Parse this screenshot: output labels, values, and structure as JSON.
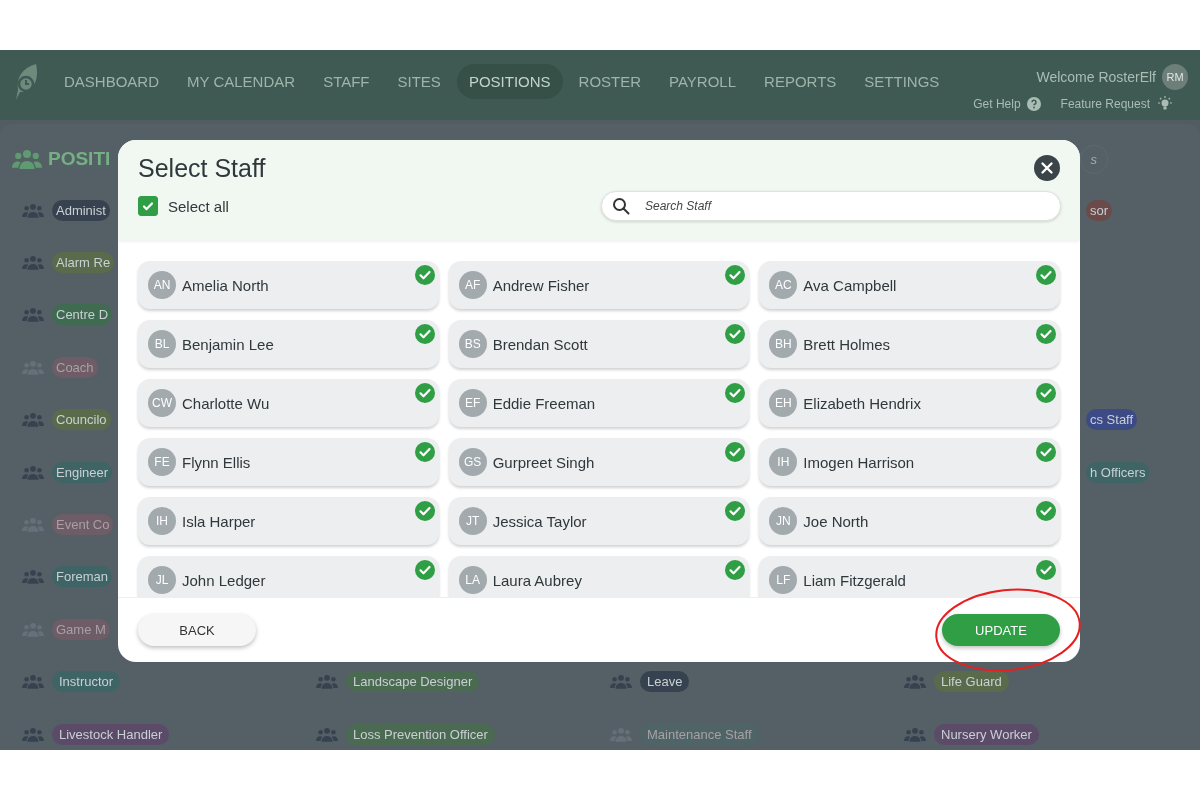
{
  "nav": {
    "items": [
      {
        "label": "DASHBOARD",
        "selected": false
      },
      {
        "label": "MY CALENDAR",
        "selected": false
      },
      {
        "label": "STAFF",
        "selected": false
      },
      {
        "label": "SITES",
        "selected": false
      },
      {
        "label": "POSITIONS",
        "selected": true
      },
      {
        "label": "ROSTER",
        "selected": false
      },
      {
        "label": "PAYROLL",
        "selected": false
      },
      {
        "label": "REPORTS",
        "selected": false
      },
      {
        "label": "SETTINGS",
        "selected": false
      }
    ],
    "welcome": "Welcome RosterElf",
    "avatar": "RM",
    "help": "Get Help",
    "feature": "Feature Request"
  },
  "background": {
    "title": "POSITI",
    "search_placeholder": "s",
    "rows": [
      {
        "left": {
          "label": "Administ",
          "color": "#36424f",
          "disabled": false
        },
        "right": {
          "label": "sor",
          "color": "#6b4a4a",
          "disabled": false
        }
      },
      {
        "left": {
          "label": "Alarm Re",
          "color": "#5a6b4c",
          "disabled": false
        }
      },
      {
        "left": {
          "label": "Centre D",
          "color": "#3f6b50",
          "disabled": false
        }
      },
      {
        "left": {
          "label": "Coach",
          "color": "#6e5c66",
          "disabled": true
        }
      },
      {
        "left": {
          "label": "Councilo",
          "color": "#5a6b4c",
          "disabled": false
        },
        "right": {
          "label": "cs Staff",
          "color": "#3c4a86",
          "disabled": false
        }
      },
      {
        "left": {
          "label": "Engineer",
          "color": "#3e6466",
          "disabled": false
        },
        "right": {
          "label": "h Officers",
          "color": "#3e6466",
          "disabled": false
        }
      },
      {
        "left": {
          "label": "Event Co",
          "color": "#6e5c66",
          "disabled": true
        }
      },
      {
        "left": {
          "label": "Foreman",
          "color": "#3e6466",
          "disabled": false
        }
      },
      {
        "left": {
          "label": "Game M",
          "color": "#6e5c66",
          "disabled": true
        }
      },
      {
        "cells": [
          {
            "label": "Instructor",
            "color": "#3e6466",
            "disabled": false
          },
          {
            "label": "Landscape Designer",
            "color": "#4b6a52",
            "disabled": false
          },
          {
            "label": "Leave",
            "color": "#36424f",
            "disabled": false
          },
          {
            "label": "Life Guard",
            "color": "#5a6b4c",
            "disabled": false
          }
        ]
      },
      {
        "cells": [
          {
            "label": "Livestock Handler",
            "color": "#5b4a68",
            "disabled": false
          },
          {
            "label": "Loss Prevention Officer",
            "color": "#4b6a52",
            "disabled": false
          },
          {
            "label": "Maintenance Staff",
            "color": "#4f6466",
            "disabled": true
          },
          {
            "label": "Nursery Worker",
            "color": "#5b4a68",
            "disabled": false
          }
        ]
      }
    ]
  },
  "modal": {
    "title": "Select Staff",
    "select_all": {
      "label": "Select all",
      "checked": true
    },
    "search": {
      "placeholder": "Search Staff"
    },
    "staff": [
      {
        "initials": "AN",
        "name": "Amelia North",
        "selected": true
      },
      {
        "initials": "AF",
        "name": "Andrew Fisher",
        "selected": true
      },
      {
        "initials": "AC",
        "name": "Ava Campbell",
        "selected": true
      },
      {
        "initials": "BL",
        "name": "Benjamin Lee",
        "selected": true
      },
      {
        "initials": "BS",
        "name": "Brendan Scott",
        "selected": true
      },
      {
        "initials": "BH",
        "name": "Brett Holmes",
        "selected": true
      },
      {
        "initials": "CW",
        "name": "Charlotte Wu",
        "selected": true
      },
      {
        "initials": "EF",
        "name": "Eddie Freeman",
        "selected": true
      },
      {
        "initials": "EH",
        "name": "Elizabeth Hendrix",
        "selected": true
      },
      {
        "initials": "FE",
        "name": "Flynn Ellis",
        "selected": true
      },
      {
        "initials": "GS",
        "name": "Gurpreet Singh",
        "selected": true
      },
      {
        "initials": "IH",
        "name": "Imogen Harrison",
        "selected": true
      },
      {
        "initials": "IH",
        "name": "Isla Harper",
        "selected": true
      },
      {
        "initials": "JT",
        "name": "Jessica Taylor",
        "selected": true
      },
      {
        "initials": "JN",
        "name": "Joe North",
        "selected": true
      },
      {
        "initials": "JL",
        "name": "John Ledger",
        "selected": true
      },
      {
        "initials": "LA",
        "name": "Laura Aubrey",
        "selected": true
      },
      {
        "initials": "LF",
        "name": "Liam Fitzgerald",
        "selected": true
      }
    ],
    "back": "BACK",
    "update": "UPDATE"
  }
}
